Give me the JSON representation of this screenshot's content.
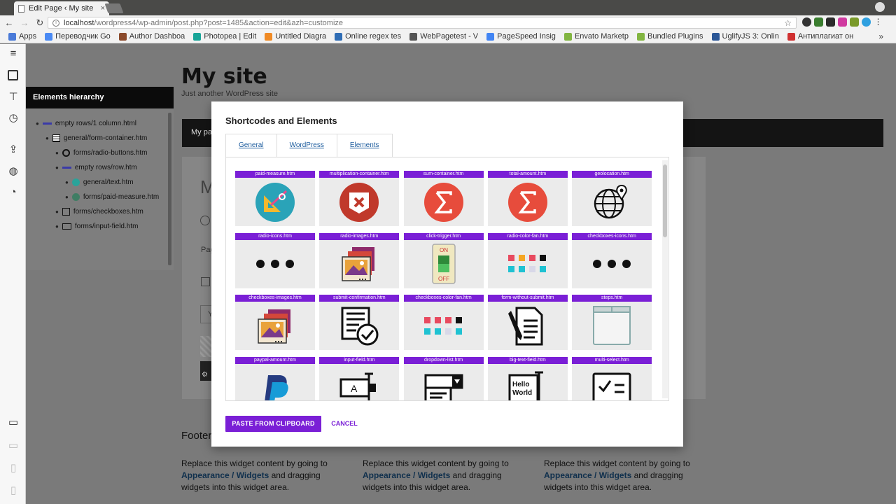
{
  "browser": {
    "tab_title": "Edit Page ‹ My site",
    "tab_close": "×",
    "url_host": "localhost",
    "url_path": "/wordpress4/wp-admin/post.php?post=1485&action=edit&azh=customize",
    "bookmarks": [
      {
        "label": "Apps",
        "color": "#4a7ad8"
      },
      {
        "label": "Переводчик Go",
        "color": "#4a8af4"
      },
      {
        "label": "Author Dashboa",
        "color": "#8b4a2b"
      },
      {
        "label": "Photopea | Edit",
        "color": "#18a497"
      },
      {
        "label": "Untitled Diagra",
        "color": "#f08a24"
      },
      {
        "label": "Online regex tes",
        "color": "#2f6db5"
      },
      {
        "label": "WebPagetest - V",
        "color": "#555555"
      },
      {
        "label": "PageSpeed Insig",
        "color": "#4285f4"
      },
      {
        "label": "Envato Marketp",
        "color": "#82b541"
      },
      {
        "label": "Bundled Plugins",
        "color": "#82b541"
      },
      {
        "label": "UglifyJS 3: Onlin",
        "color": "#2b5797"
      },
      {
        "label": "Антиплагиат он",
        "color": "#d03030"
      }
    ],
    "more": "»"
  },
  "site": {
    "title": "My site",
    "tagline": "Just another WordPress site",
    "menu_item": "My pa",
    "frag_heading": "M",
    "frag_text": "Pag",
    "frag_input": "Y",
    "footer_heading": "Footer",
    "widget_text_1": "Replace this widget content by going to",
    "widget_link": "Appearance / Widgets",
    "widget_text_2": " and dragging",
    "widget_text_3": "widgets into this widget area."
  },
  "hierarchy": {
    "title": "Elements hierarchy",
    "nodes": [
      {
        "label": "empty rows/1 column.html"
      },
      {
        "label": "general/form-container.htm"
      },
      {
        "label": "forms/radio-buttons.htm"
      },
      {
        "label": "empty rows/row.htm"
      },
      {
        "label": "general/text.htm"
      },
      {
        "label": "forms/paid-measure.htm"
      },
      {
        "label": "forms/checkboxes.htm"
      },
      {
        "label": "forms/input-field.htm"
      }
    ]
  },
  "modal": {
    "title": "Shortcodes and Elements",
    "tabs": [
      "General",
      "WordPress",
      "Elements"
    ],
    "items": [
      "paid-measure.htm",
      "multiplication-container.htm",
      "sum-container.htm",
      "total-amount.htm",
      "geolocation.htm",
      "radio-icons.htm",
      "radio-images.htm",
      "click-trigger.htm",
      "radio-color-fan.htm",
      "checkboxes-icons.htm",
      "checkboxes-images.htm",
      "submit-confirmation.htm",
      "checkboxes-color-fan.htm",
      "form-without-submit.htm",
      "steps.htm",
      "paypal-amount.htm",
      "input-field.htm",
      "dropdown-list.htm",
      "big-text-field.htm",
      "multi-select.htm"
    ],
    "icon_text": {
      "on": "ON",
      "off": "OFF",
      "input_letter": "A",
      "hello": "Hello",
      "world": "World",
      "paypal": "PayPal"
    },
    "paste_button": "PASTE FROM CLIPBOARD",
    "cancel_button": "CANCEL"
  },
  "colors": {
    "accent": "#7a1fd6",
    "link": "#1e5d9e",
    "sum_red": "#e74c3c",
    "close_red": "#c0392b"
  }
}
